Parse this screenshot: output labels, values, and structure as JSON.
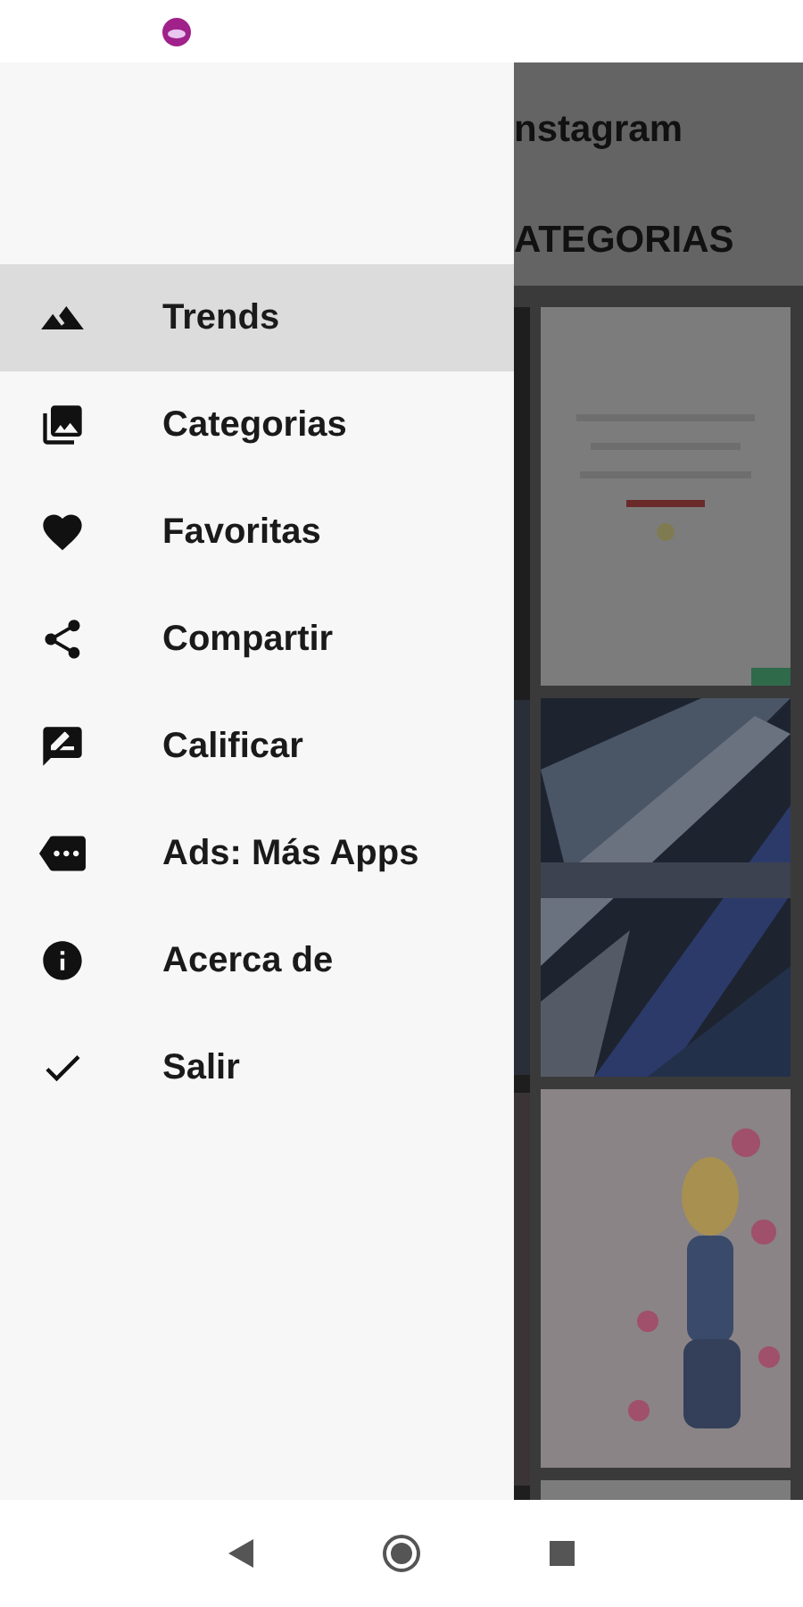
{
  "drawer": {
    "items": [
      {
        "label": "Trends",
        "selected": true
      },
      {
        "label": "Categorias",
        "selected": false
      },
      {
        "label": "Favoritas",
        "selected": false
      },
      {
        "label": "Compartir",
        "selected": false
      },
      {
        "label": "Calificar",
        "selected": false
      },
      {
        "label": "Ads: Más Apps",
        "selected": false
      },
      {
        "label": "Acerca de",
        "selected": false
      },
      {
        "label": "Salir",
        "selected": false
      }
    ]
  },
  "background": {
    "title": "nstagram",
    "tab": "ATEGORIAS"
  }
}
